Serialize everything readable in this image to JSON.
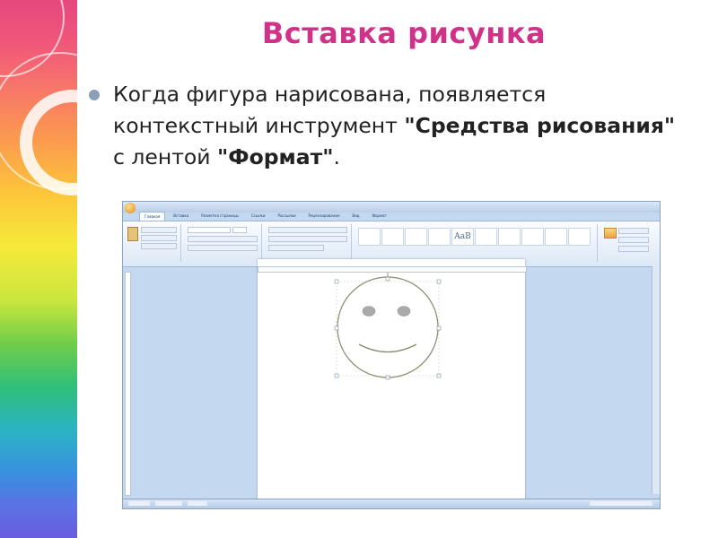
{
  "slide": {
    "title": "Вставка рисунка",
    "bullet": {
      "part1": "Когда фигура нарисована, появляется контекстный инструмент ",
      "bold1": "\"Средства рисования\"",
      "part2": " с лентой ",
      "bold2": "\"Формат\"",
      "part3": "."
    }
  },
  "word_window": {
    "tabs": [
      "Главная",
      "Вставка",
      "Разметка страницы",
      "Ссылки",
      "Рассылки",
      "Рецензирование",
      "Вид",
      "Формат"
    ],
    "active_tab_index": 0,
    "styles_sample": "AaB"
  },
  "colors": {
    "title": "#d0328a",
    "text": "#222222",
    "bullet": "#8c9fb8",
    "shape_stroke": "#8a8a6a",
    "eye_fill": "#aaaaaa",
    "handle": "#5f8a6a"
  }
}
